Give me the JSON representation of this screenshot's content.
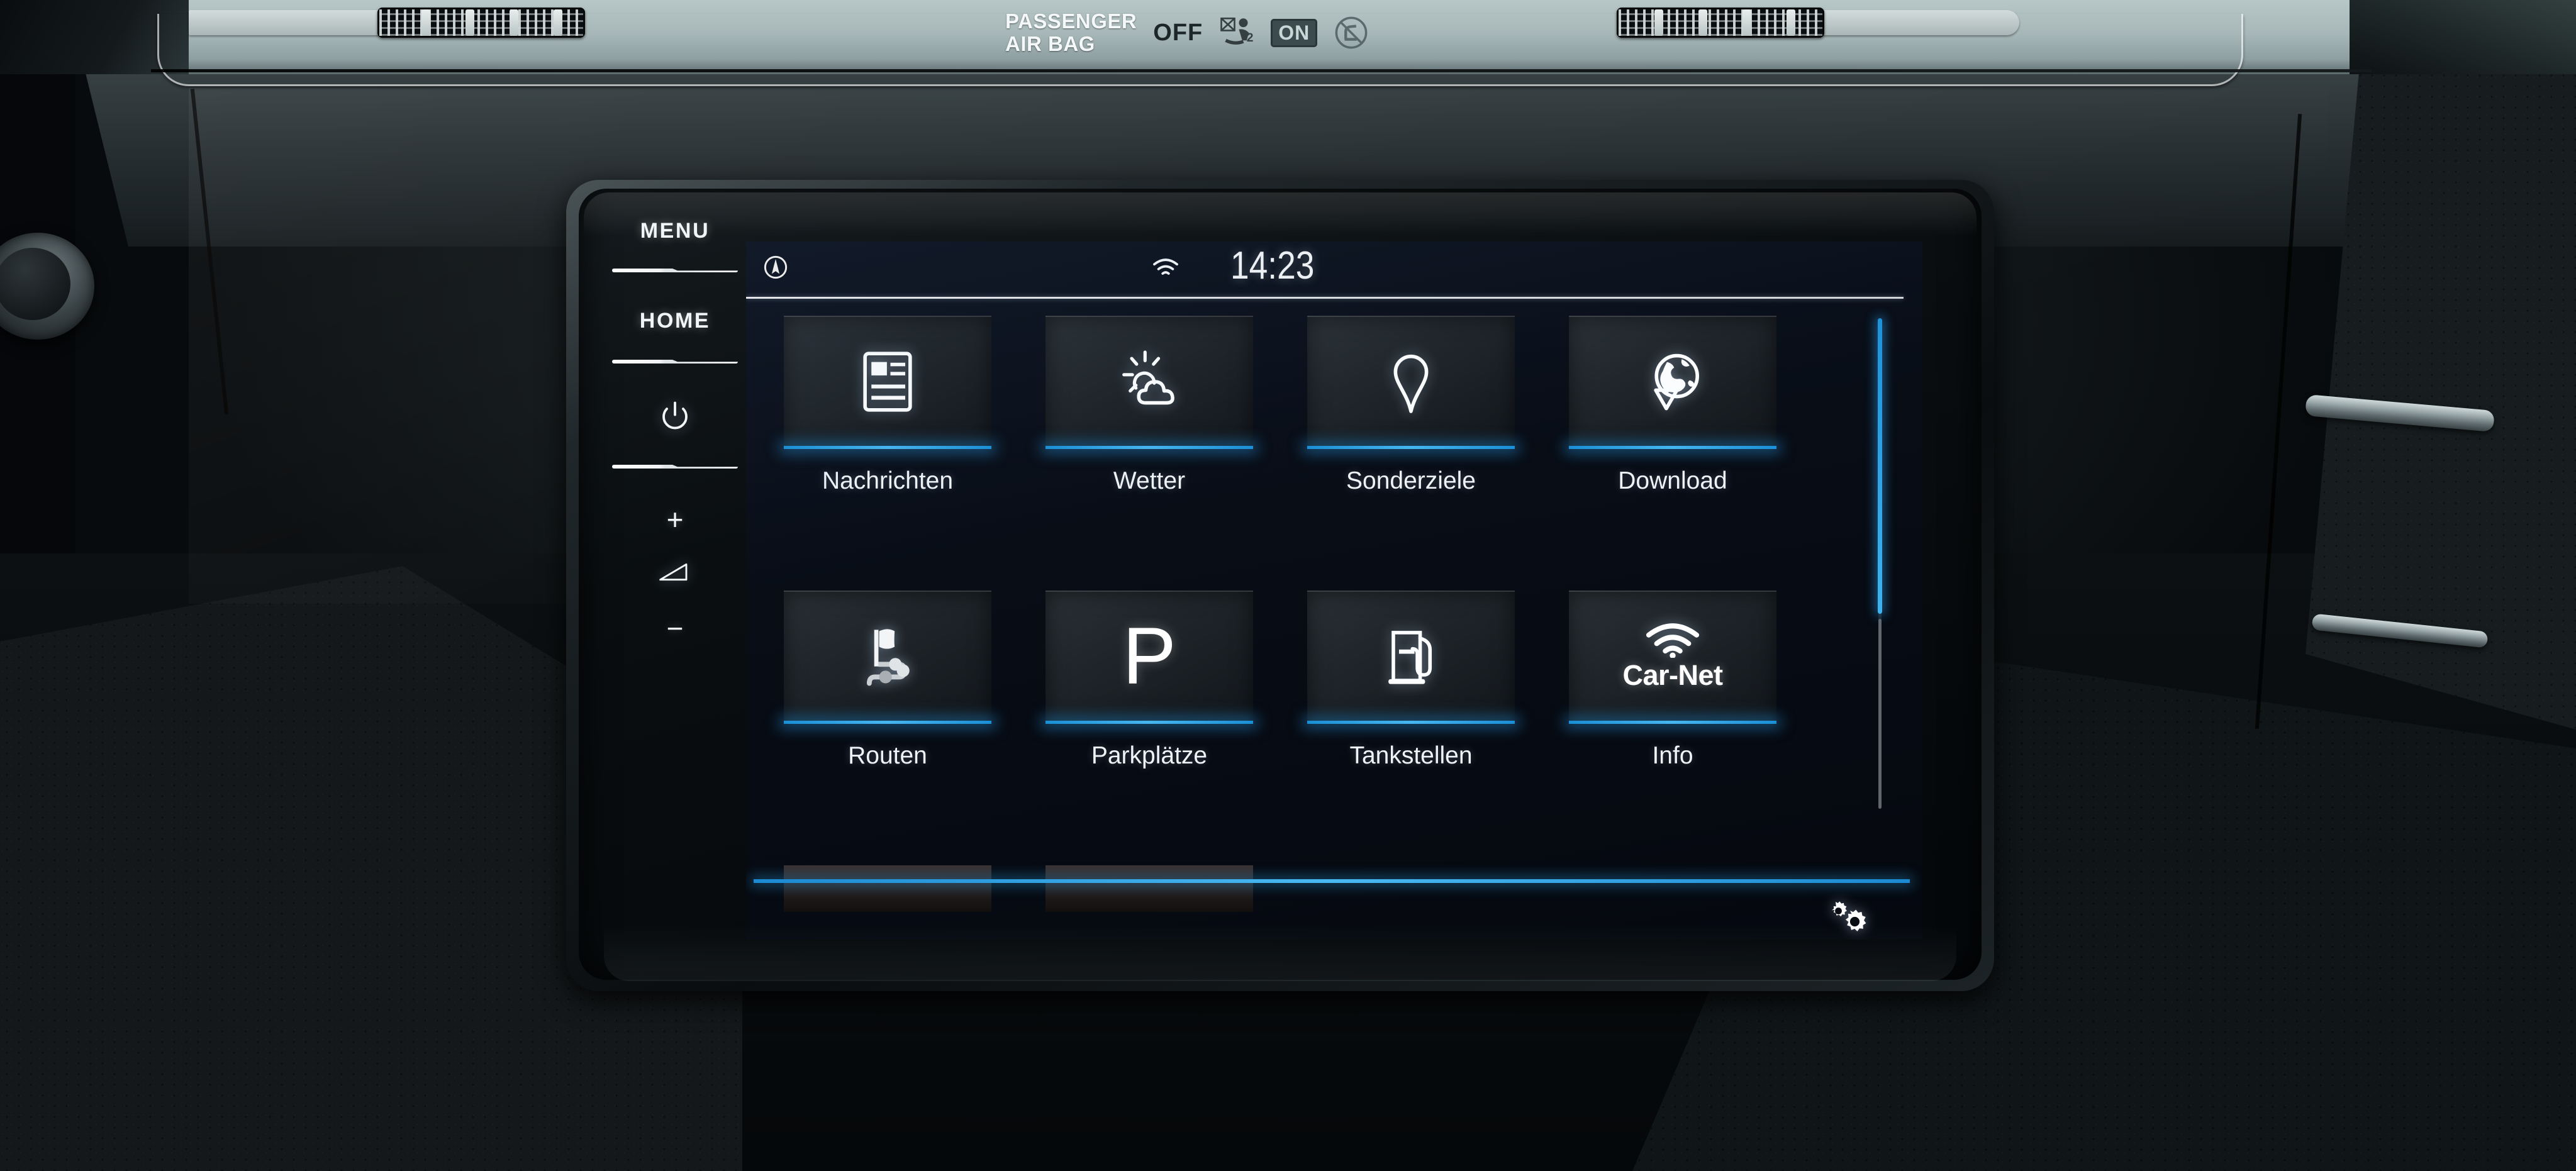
{
  "vehicle": {
    "airbag_warning": {
      "title_line1": "PASSENGER",
      "title_line2": "AIR BAG",
      "off_label": "OFF",
      "on_label": "ON",
      "off_icon": "airbag-disabled-child-icon",
      "on_icon": "no-child-seat-icon"
    },
    "vent_left_icon": "air-vent-grille-icon",
    "vent_right_icon": "air-vent-grille-icon",
    "gear_knob_icon": "gear-shift-knob-icon"
  },
  "head_unit": {
    "hard_keys": [
      {
        "id": "menu",
        "label": "MENU",
        "type": "text"
      },
      {
        "id": "home",
        "label": "HOME",
        "type": "text"
      },
      {
        "id": "power",
        "label": "",
        "type": "icon",
        "icon": "power-icon"
      },
      {
        "id": "vol-up",
        "label": "+",
        "type": "text"
      },
      {
        "id": "volume",
        "label": "",
        "type": "icon",
        "icon": "volume-wedge-icon"
      },
      {
        "id": "vol-down",
        "label": "−",
        "type": "text"
      }
    ]
  },
  "screen": {
    "status_bar": {
      "nav_icon": "compass-navigation-icon",
      "wifi_icon": "wifi-icon",
      "clock": "14:23"
    },
    "tiles": [
      {
        "label": "Nachrichten",
        "icon": "news-article-icon",
        "selected": true
      },
      {
        "label": "Wetter",
        "icon": "sun-cloud-weather-icon",
        "selected": true
      },
      {
        "label": "Sonderziele",
        "icon": "map-pin-icon",
        "selected": true
      },
      {
        "label": "Download",
        "icon": "globe-download-icon",
        "selected": true
      },
      {
        "label": "Routen",
        "icon": "flag-route-waypoints-icon",
        "selected": true
      },
      {
        "label": "Parkplätze",
        "icon": "parking-p-icon",
        "selected": true
      },
      {
        "label": "Tankstellen",
        "icon": "fuel-pump-icon",
        "selected": true
      },
      {
        "label": "Info",
        "icon": "car-net-wifi-icon",
        "brand_text": "Car-Net",
        "selected": true
      }
    ],
    "partial_row_tiles": 2,
    "settings_icon": "two-gears-settings-icon",
    "scrollbar": {
      "position_percent": 0,
      "thumb_fraction": 0.6
    },
    "accent_color": "#2f9fe0",
    "text_color": "#eef3f7",
    "tile_bg_color": "#23292e"
  }
}
